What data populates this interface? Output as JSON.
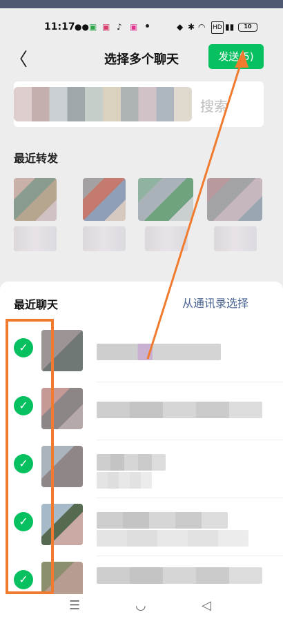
{
  "status_bar": {
    "time": "11:17",
    "battery": "10",
    "icons": [
      "wechat-icon",
      "app-icon",
      "app-icon",
      "tiktok-icon",
      "app-icon",
      "dot-icon",
      "location-icon",
      "bluetooth-icon",
      "wifi-icon",
      "hd-icon",
      "signal-icon",
      "battery-icon"
    ]
  },
  "nav": {
    "back_glyph": "〈",
    "title": "选择多个聊天",
    "send_label": "发送(5)"
  },
  "search": {
    "placeholder": "搜索"
  },
  "recent_forward": {
    "label": "最近转发"
  },
  "recent_chats": {
    "label": "最近聊天",
    "contacts_link": "从通讯录选择"
  },
  "colors": {
    "accent": "#07c160",
    "link": "#4a6394",
    "annotation": "#f07b2f"
  },
  "system_nav": {
    "menu": "☰",
    "home": "◡",
    "back": "◁"
  }
}
